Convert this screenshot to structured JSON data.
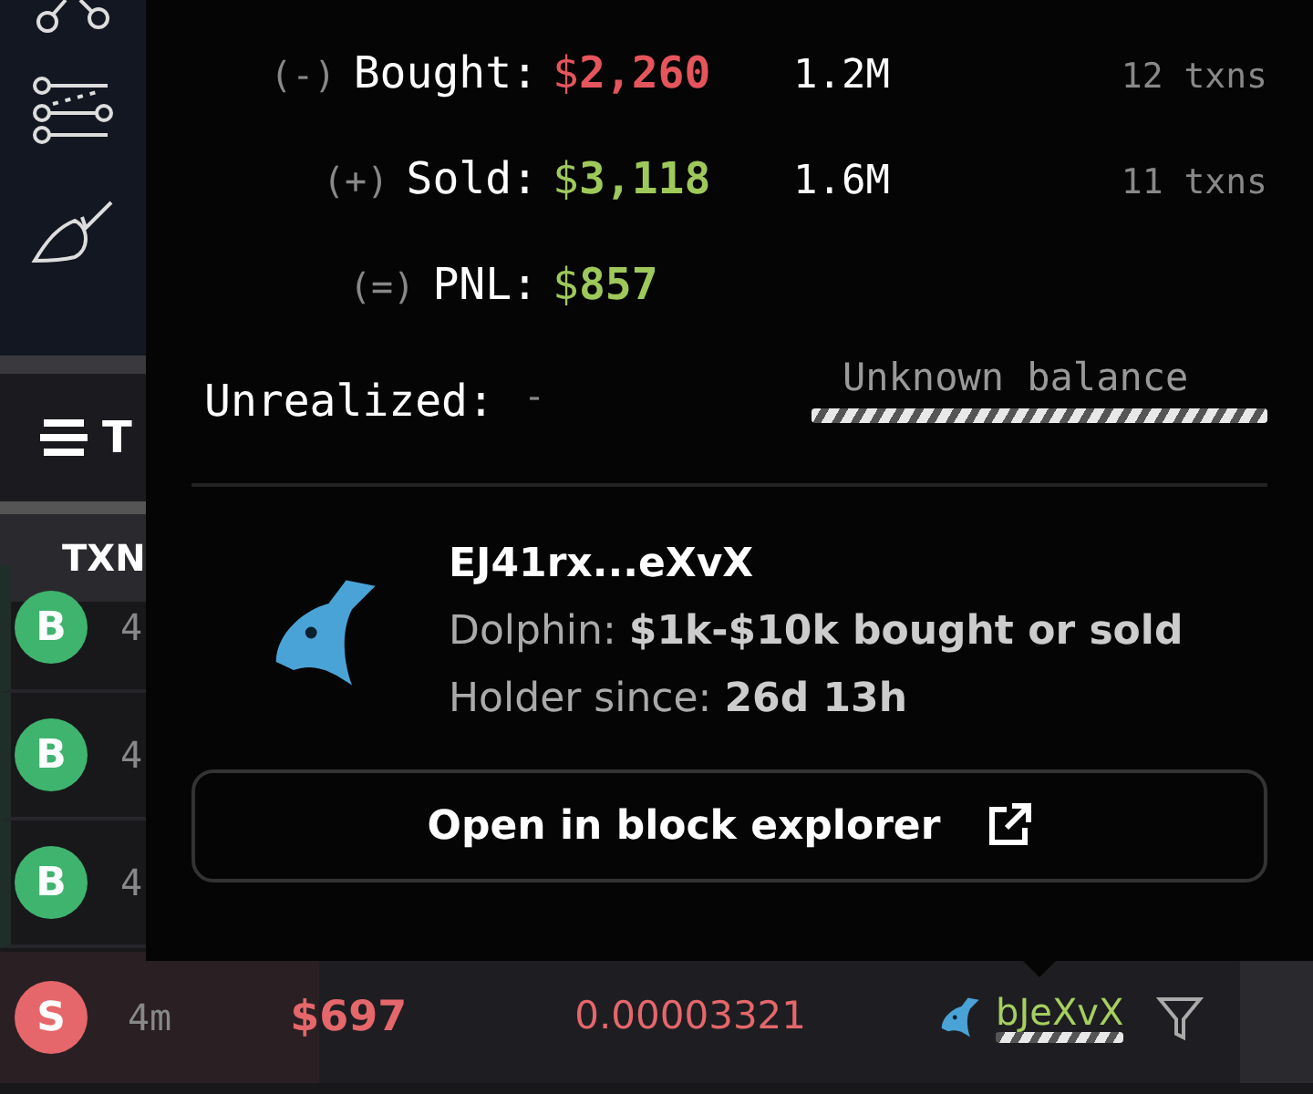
{
  "panel": {
    "title": "T"
  },
  "table": {
    "columns": [
      "TXN"
    ],
    "rows": [
      {
        "type": "B",
        "age": "4",
        "selected": false
      },
      {
        "type": "B",
        "age": "4",
        "selected": false
      },
      {
        "type": "B",
        "age": "4",
        "selected": false
      },
      {
        "type": "S",
        "age": "4m",
        "usd": "$697",
        "price": "0.00003321",
        "maker": "bJeXvX",
        "selected": true
      }
    ]
  },
  "popover": {
    "stats": [
      {
        "sign": "(-)",
        "label": "Bought:",
        "usd": "$**2,260**",
        "tokens": "1.2M",
        "txns": "12 txns",
        "kind": "loss"
      },
      {
        "sign": "(+)",
        "label": "Sold:",
        "usd": "$**3,118**",
        "tokens": "1.6M",
        "txns": "11 txns",
        "kind": "gain"
      },
      {
        "sign": "(=)",
        "label": "PNL:",
        "usd": "$**857**",
        "kind": "gain"
      }
    ],
    "unrealized": {
      "label": "Unrealized:",
      "value": "-",
      "balance": "Unknown balance"
    },
    "wallet": {
      "address": "EJ41rx...eXvX",
      "tier": "Dolphin: **$1k-$10k bought or sold**",
      "since": "Holder since: **26d 13h**"
    },
    "button": "Open in block explorer"
  }
}
